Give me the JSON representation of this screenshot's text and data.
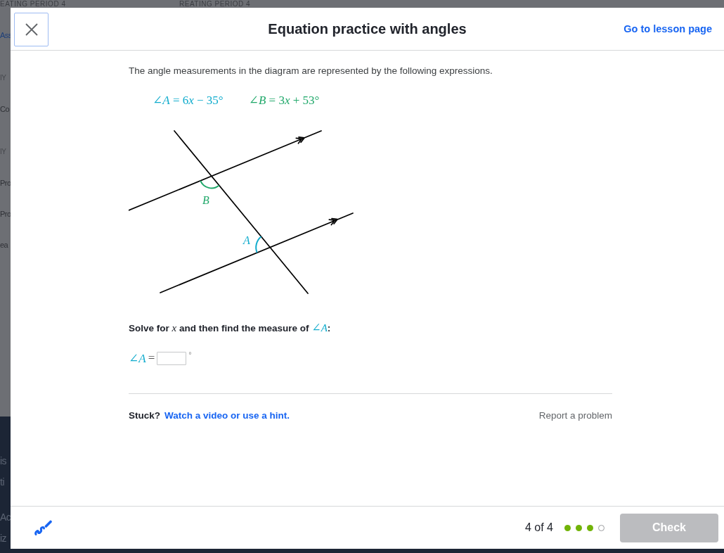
{
  "background": {
    "top_labels": [
      "EATING PERIOD 4",
      "REATING PERIOD 4"
    ],
    "sidebar": [
      {
        "text": "Ass",
        "kind": "link"
      },
      {
        "text": "IY",
        "kind": "heading"
      },
      {
        "text": "Co",
        "kind": "item"
      },
      {
        "text": "IY",
        "kind": "heading"
      },
      {
        "text": "Pro",
        "kind": "item"
      },
      {
        "text": "Pro",
        "kind": "item"
      },
      {
        "text": "ea",
        "kind": "item"
      }
    ],
    "banner": [
      {
        "lines": [
          "is",
          "ti"
        ]
      },
      {
        "lines": [
          "Ac",
          "iz"
        ]
      }
    ]
  },
  "dialog": {
    "title": "Equation practice with angles",
    "lesson_link": "Go to lesson page"
  },
  "question": {
    "intro": "The angle measurements in the diagram are represented by the following expressions.",
    "expressions": [
      {
        "parts": [
          "∠*A* = 6",
          "*x*",
          " − 35°"
        ],
        "color": "#11accd"
      },
      {
        "parts": [
          "∠*B* = 3",
          "*x*",
          " + 53°"
        ],
        "color": "#20a86a"
      }
    ],
    "diagram": {
      "angles": [
        {
          "label": "B",
          "color": "#20a86a"
        },
        {
          "label": "A",
          "color": "#11accd"
        }
      ]
    },
    "prompt": {
      "text": "Solve for *x* and then find the measure of",
      "math": "∠*A*",
      "end": ":"
    },
    "answer": {
      "label": "∠*A*",
      "relation": "=",
      "unit": "°"
    }
  },
  "help": {
    "stuck": "Stuck?",
    "hint_link": "Watch a video or use a hint.",
    "report_link": "Report a problem"
  },
  "footer": {
    "progress": {
      "label": "4 of 4",
      "dots": [
        {
          "done": true
        },
        {
          "done": true
        },
        {
          "done": true
        },
        {
          "done": false
        }
      ]
    },
    "check": {
      "label": "Check",
      "disabled": true
    }
  }
}
